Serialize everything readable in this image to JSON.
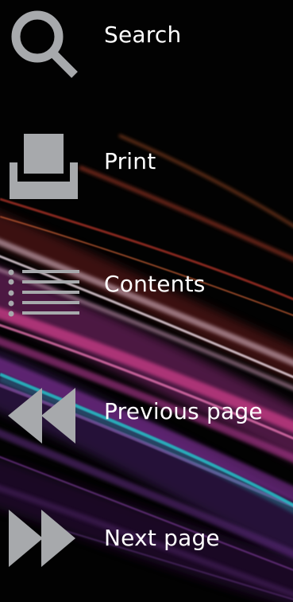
{
  "menu": {
    "items": [
      {
        "label": "Search",
        "icon": "search-icon"
      },
      {
        "label": "Print",
        "icon": "print-icon"
      },
      {
        "label": "Contents",
        "icon": "contents-list-icon"
      },
      {
        "label": "Previous page",
        "icon": "rewind-icon"
      },
      {
        "label": "Next page",
        "icon": "fast-forward-icon"
      }
    ]
  },
  "colors": {
    "background": "#020202",
    "icon": "#a7a9ac",
    "label": "#ffffff",
    "streak_colors": [
      "#c0392b",
      "#e8d4e0",
      "#d43f8d",
      "#7a2f8f",
      "#27c0c8"
    ]
  }
}
